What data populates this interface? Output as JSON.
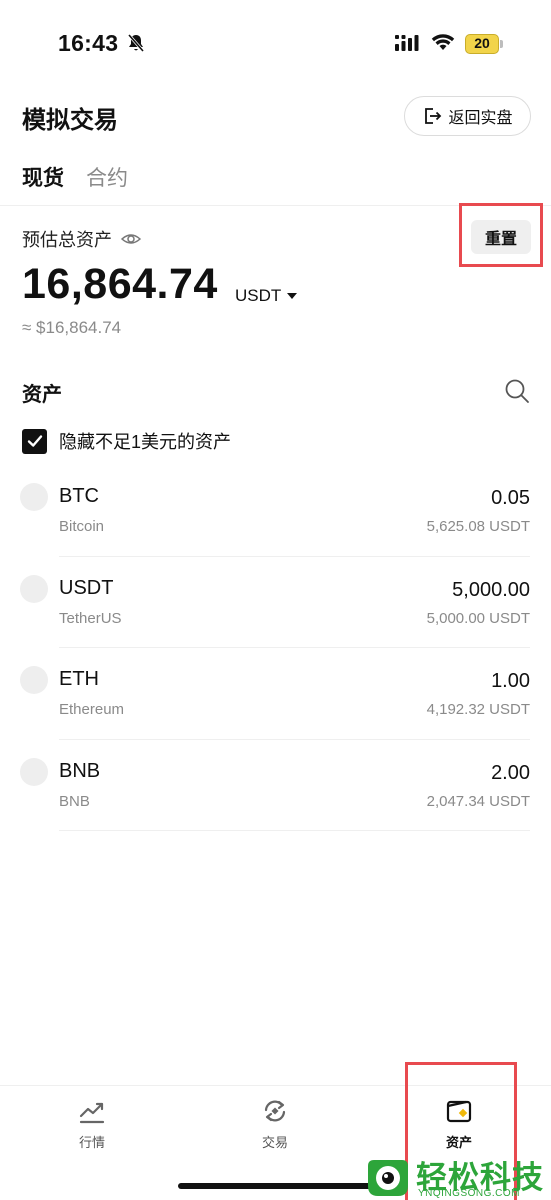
{
  "status_bar": {
    "time": "16:43",
    "battery": "20"
  },
  "header": {
    "title": "模拟交易",
    "return_button": "返回实盘"
  },
  "tabs": [
    {
      "label": "现货",
      "active": true
    },
    {
      "label": "合约",
      "active": false
    }
  ],
  "summary": {
    "label": "预估总资产",
    "reset_button": "重置",
    "total": "16,864.74",
    "unit": "USDT",
    "approx": "≈ $16,864.74"
  },
  "assets": {
    "title": "资产",
    "hide_small_label": "隐藏不足1美元的资产",
    "hide_small_checked": true,
    "items": [
      {
        "symbol": "BTC",
        "name": "Bitcoin",
        "amount": "0.05",
        "value": "5,625.08 USDT"
      },
      {
        "symbol": "USDT",
        "name": "TetherUS",
        "amount": "5,000.00",
        "value": "5,000.00 USDT"
      },
      {
        "symbol": "ETH",
        "name": "Ethereum",
        "amount": "1.00",
        "value": "4,192.32 USDT"
      },
      {
        "symbol": "BNB",
        "name": "BNB",
        "amount": "2.00",
        "value": "2,047.34 USDT"
      }
    ]
  },
  "bottom_nav": [
    {
      "label": "行情",
      "icon": "chart-trend-icon",
      "active": false
    },
    {
      "label": "交易",
      "icon": "exchange-icon",
      "active": false
    },
    {
      "label": "资产",
      "icon": "wallet-icon",
      "active": true
    }
  ],
  "watermark": {
    "text": "轻松科技",
    "sub": "YNQINGSONG.COM"
  },
  "colors": {
    "highlight": "#e84a4f",
    "watermark": "#2da53a",
    "battery": "#f2d44a"
  }
}
